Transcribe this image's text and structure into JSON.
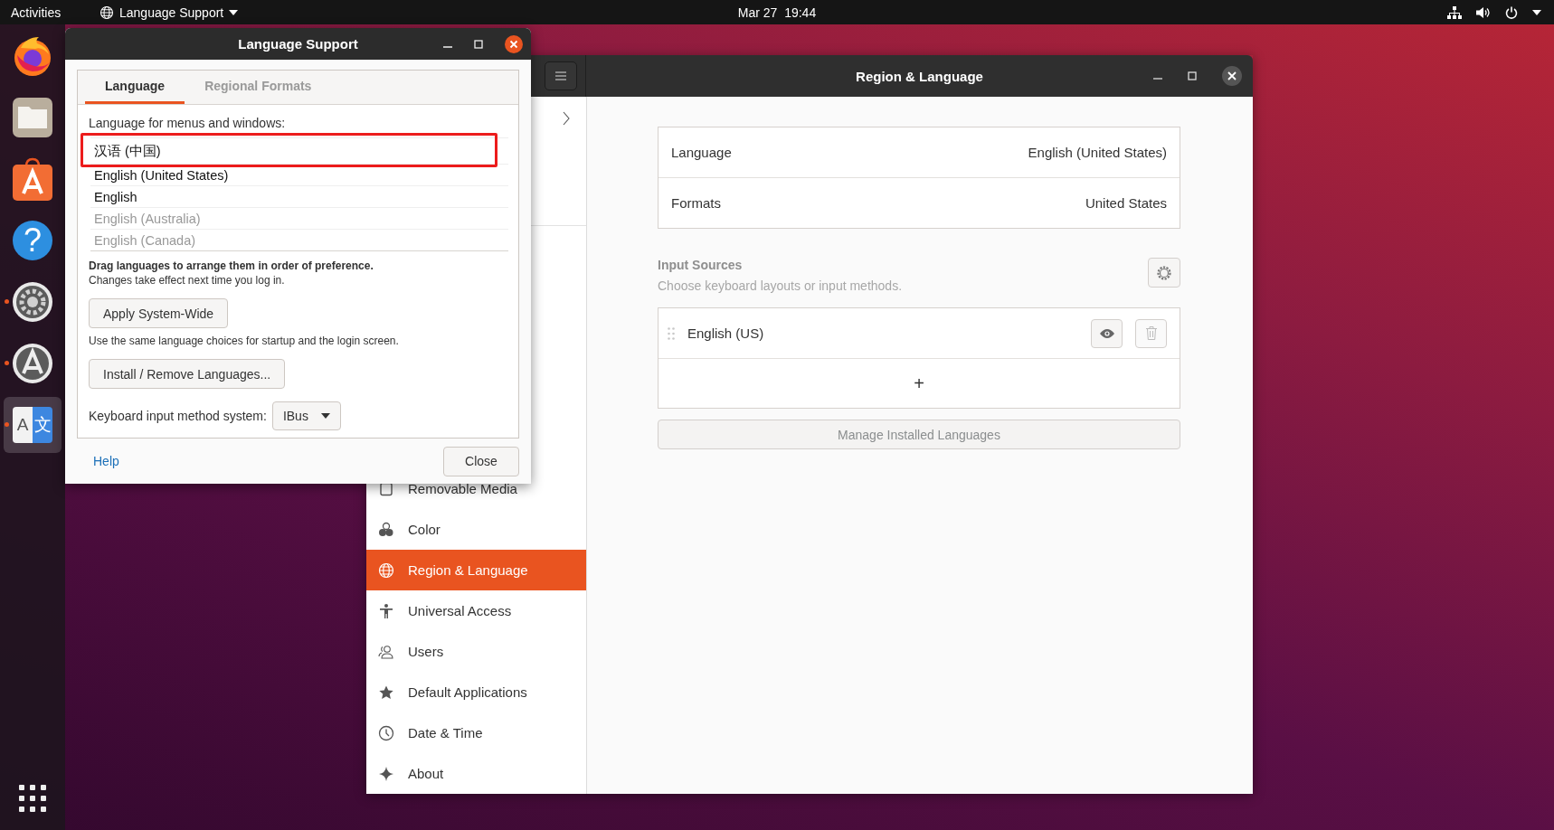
{
  "top_bar": {
    "activities": "Activities",
    "app_menu": "Language Support",
    "clock": "Mar 27  19:44"
  },
  "dock": {
    "items": [
      {
        "kind": "firefox",
        "running": false,
        "selected": false
      },
      {
        "kind": "files",
        "running": false,
        "selected": false
      },
      {
        "kind": "software",
        "running": false,
        "selected": false
      },
      {
        "kind": "help",
        "glyphs": [
          "?"
        ],
        "running": false,
        "selected": false
      },
      {
        "kind": "settings",
        "running": true,
        "selected": false
      },
      {
        "kind": "updater",
        "running": true,
        "selected": false
      },
      {
        "kind": "language",
        "glyphs": [
          "A",
          "文"
        ],
        "running": true,
        "selected": true
      }
    ]
  },
  "settings_window": {
    "title": "Region & Language",
    "sidebar": {
      "items": [
        {
          "kind": "removable",
          "label": "Removable Media",
          "selected": false
        },
        {
          "kind": "color",
          "label": "Color",
          "selected": false
        },
        {
          "kind": "globe",
          "label": "Region & Language",
          "selected": true
        },
        {
          "kind": "access",
          "label": "Universal Access",
          "selected": false
        },
        {
          "kind": "users",
          "label": "Users",
          "selected": false
        },
        {
          "kind": "star",
          "label": "Default Applications",
          "selected": false
        },
        {
          "kind": "clock",
          "label": "Date & Time",
          "selected": false
        },
        {
          "kind": "about",
          "label": "About",
          "selected": false
        }
      ]
    },
    "settings_rows": [
      {
        "label": "Language",
        "value": "English (United States)"
      },
      {
        "label": "Formats",
        "value": "United States"
      }
    ],
    "input_sources": {
      "title": "Input Sources",
      "subtitle": "Choose keyboard layouts or input methods.",
      "sources": [
        "English (US)"
      ],
      "add": "+"
    },
    "manage_button": "Manage Installed Languages"
  },
  "language_support": {
    "title": "Language Support",
    "tabs": [
      {
        "label": "Language",
        "selected": true
      },
      {
        "label": "Regional Formats",
        "selected": false
      }
    ],
    "list_label": "Language for menus and windows:",
    "languages": [
      {
        "name": "汉语 (中国)",
        "installed": true,
        "highlighted": true
      },
      {
        "name": "English (United States)",
        "installed": true,
        "highlighted": false
      },
      {
        "name": "English",
        "installed": true,
        "highlighted": false
      },
      {
        "name": "English (Australia)",
        "installed": false,
        "highlighted": false
      },
      {
        "name": "English (Canada)",
        "installed": false,
        "highlighted": false
      }
    ],
    "drag_hint": "Drag languages to arrange them in order of preference.",
    "changes_hint": "Changes take effect next time you log in.",
    "apply_button": "Apply System-Wide",
    "apply_hint": "Use the same language choices for startup and the login screen.",
    "install_button": "Install / Remove Languages...",
    "input_method_label": "Keyboard input method system:",
    "input_method_value": "IBus",
    "help_link": "Help",
    "close_button": "Close"
  }
}
